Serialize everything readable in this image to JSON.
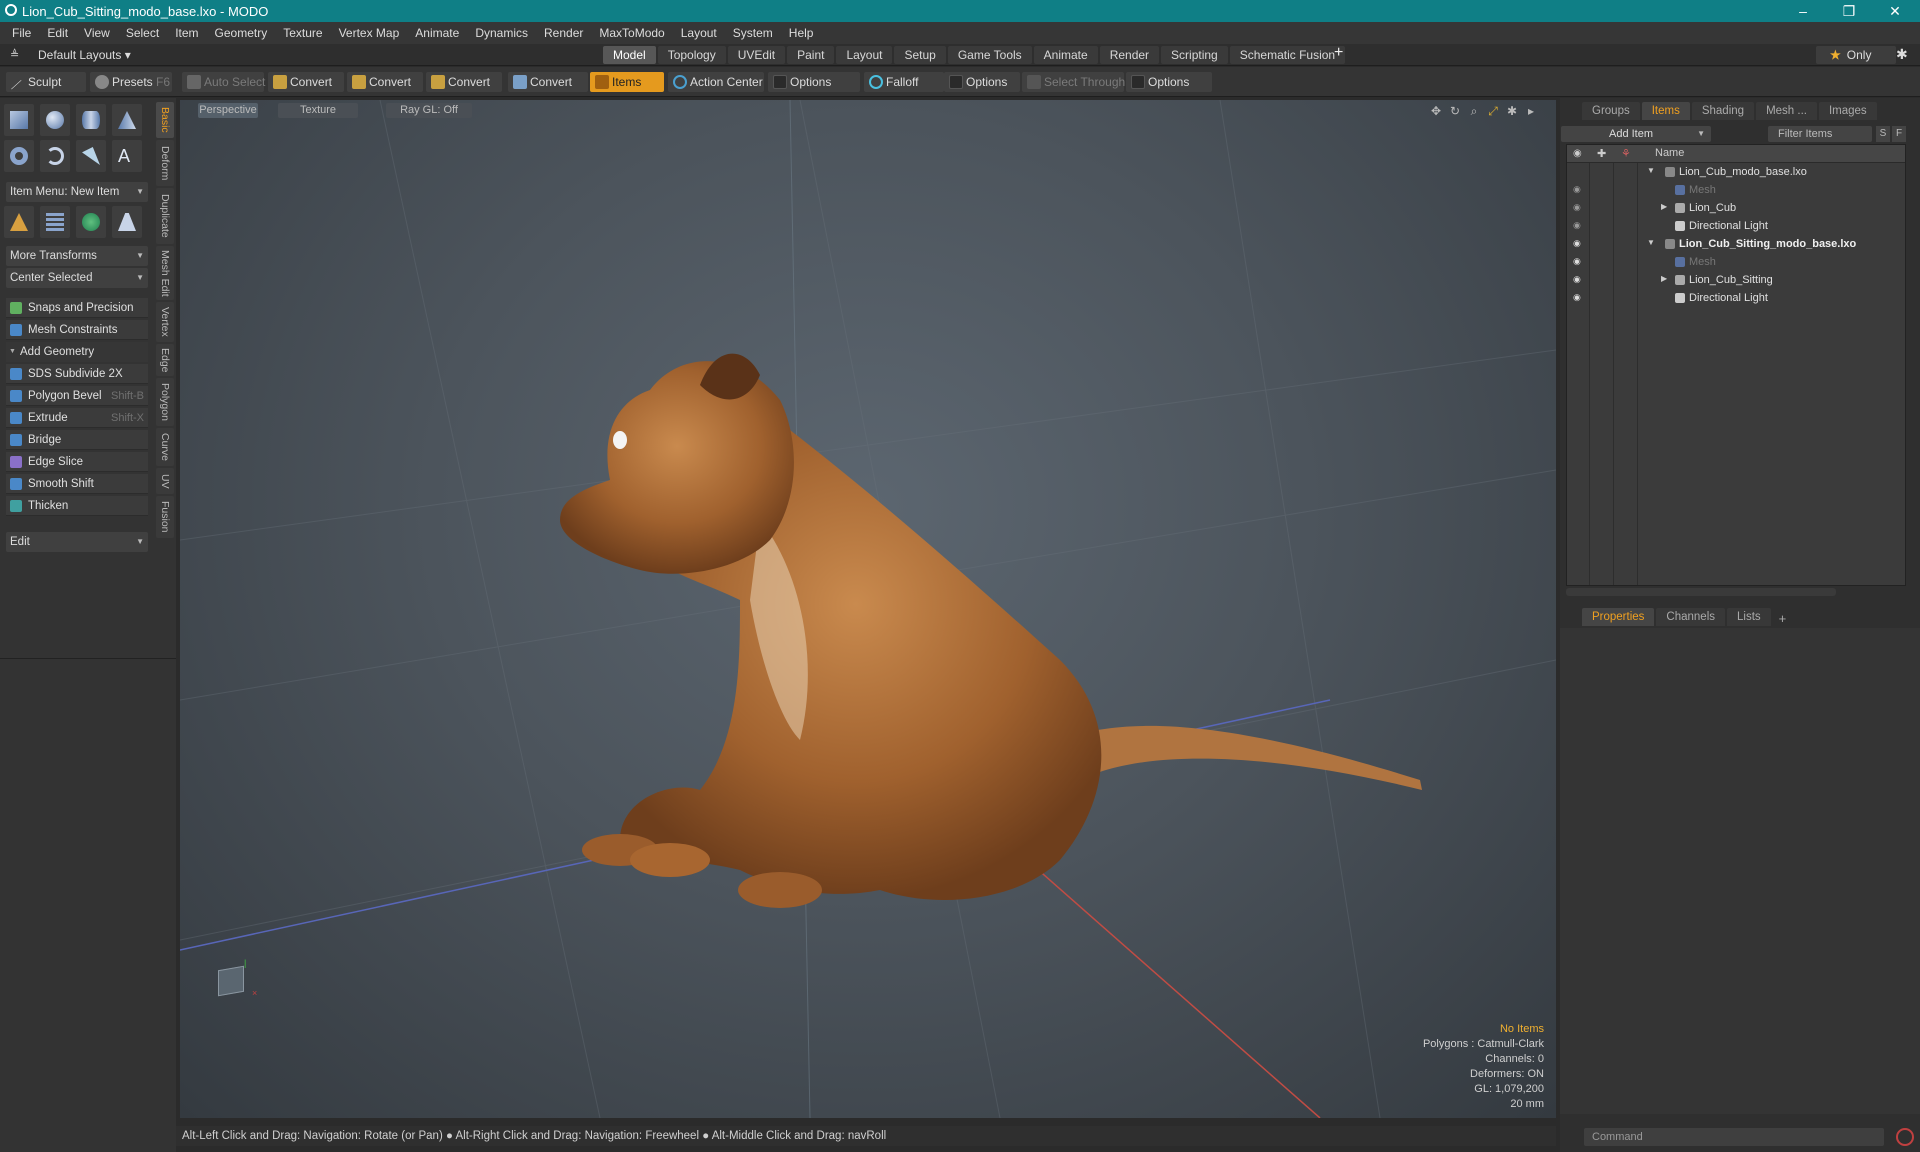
{
  "window": {
    "title": "Lion_Cub_Sitting_modo_base.lxo - MODO",
    "min": "–",
    "max": "❐",
    "close": "✕"
  },
  "menu": [
    "File",
    "Edit",
    "View",
    "Select",
    "Item",
    "Geometry",
    "Texture",
    "Vertex Map",
    "Animate",
    "Dynamics",
    "Render",
    "MaxToModo",
    "Layout",
    "System",
    "Help"
  ],
  "layoutbar": {
    "default_layouts": "Default Layouts ▾",
    "tabs": [
      "Model",
      "Topology",
      "UVEdit",
      "Paint",
      "Layout",
      "Setup",
      "Game Tools",
      "Animate",
      "Render",
      "Scripting",
      "Schematic Fusion"
    ],
    "active_tab": "Model",
    "plus": "+",
    "only": "Only",
    "star": "★"
  },
  "toolbar": {
    "sculpt": "Sculpt",
    "presets": "Presets",
    "presets_key": "F6",
    "auto_select": "Auto Select",
    "convert": "Convert",
    "items": "Items",
    "action_center": "Action Center",
    "options": "Options",
    "falloff": "Falloff",
    "select_through": "Select Through"
  },
  "left": {
    "item_menu": "Item Menu: New Item",
    "more_transforms": "More Transforms",
    "center_selected": "Center Selected",
    "snaps": "Snaps and Precision",
    "mesh_constraints": "Mesh Constraints",
    "add_geometry": "Add Geometry",
    "tools": [
      {
        "label": "SDS Subdivide 2X",
        "key": ""
      },
      {
        "label": "Polygon Bevel",
        "key": "Shift-B"
      },
      {
        "label": "Extrude",
        "key": "Shift-X"
      },
      {
        "label": "Bridge",
        "key": ""
      },
      {
        "label": "Edge Slice",
        "key": ""
      },
      {
        "label": "Smooth Shift",
        "key": ""
      },
      {
        "label": "Thicken",
        "key": ""
      }
    ],
    "edit": "Edit",
    "vtabs": [
      "Basic",
      "Deform",
      "Duplicate",
      "Mesh Edit",
      "Vertex",
      "Edge",
      "Polygon",
      "Curve",
      "UV",
      "Fusion"
    ]
  },
  "viewport": {
    "perspective": "Perspective",
    "texture": "Texture",
    "raygl": "Ray GL: Off",
    "info": {
      "no_items": "No Items",
      "polygons": "Polygons : Catmull-Clark",
      "channels": "Channels: 0",
      "deformers": "Deformers: ON",
      "gl": "GL: 1,079,200",
      "mm": "20 mm"
    }
  },
  "status": "Alt-Left Click and Drag: Navigation: Rotate (or Pan) ● Alt-Right Click and Drag: Navigation: Freewheel ● Alt-Middle Click and Drag: navRoll",
  "right": {
    "tabs": [
      "Groups",
      "Items",
      "Shading",
      "Mesh ...",
      "Images"
    ],
    "active": "Items",
    "add_item": "Add Item",
    "filter": "Filter Items",
    "s": "S",
    "f": "F",
    "name_col": "Name",
    "tree": [
      {
        "label": "Lion_Cub_modo_base.lxo",
        "style": "normal"
      },
      {
        "label": "Mesh",
        "style": "dim"
      },
      {
        "label": "Lion_Cub",
        "style": "normal"
      },
      {
        "label": "Directional Light",
        "style": "normal"
      },
      {
        "label": "Lion_Cub_Sitting_modo_base.lxo",
        "style": "bold"
      },
      {
        "label": "Mesh",
        "style": "dim"
      },
      {
        "label": "Lion_Cub_Sitting",
        "style": "normal"
      },
      {
        "label": "Directional Light",
        "style": "normal"
      }
    ],
    "prop_tabs": [
      "Properties",
      "Channels",
      "Lists"
    ],
    "prop_active": "Properties",
    "command": "Command"
  },
  "colors": {
    "titlebar": "#0f7f86",
    "accent": "#e59a1e",
    "viewport": "#4c545c"
  }
}
